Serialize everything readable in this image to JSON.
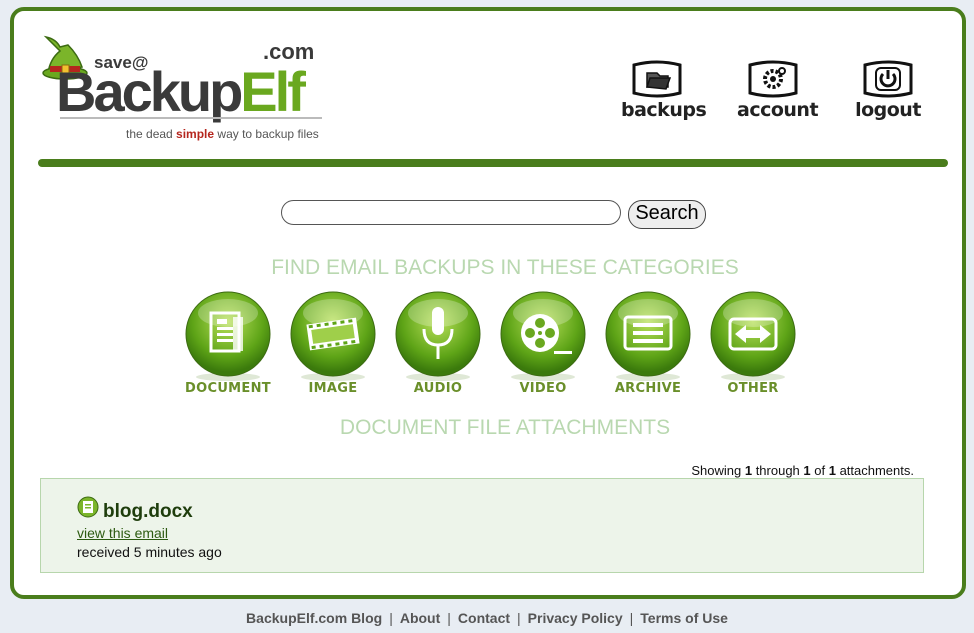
{
  "logo": {
    "dotcom": ".com",
    "save": "save@",
    "backup": "Backup",
    "elf": "Elf",
    "tagline_pre": "the dead ",
    "tagline_em": "simple",
    "tagline_post": " way to backup files"
  },
  "nav": {
    "backups": "backups",
    "account": "account",
    "logout": "logout"
  },
  "search": {
    "value": "",
    "button": "Search"
  },
  "categories_heading": "FIND EMAIL BACKUPS IN THESE CATEGORIES",
  "categories": [
    {
      "label": "DOCUMENT",
      "icon": "document-icon"
    },
    {
      "label": "IMAGE",
      "icon": "film-strip-icon"
    },
    {
      "label": "AUDIO",
      "icon": "microphone-icon"
    },
    {
      "label": "VIDEO",
      "icon": "film-reel-icon"
    },
    {
      "label": "ARCHIVE",
      "icon": "archive-icon"
    },
    {
      "label": "OTHER",
      "icon": "arrows-icon"
    }
  ],
  "results_heading": "DOCUMENT FILE ATTACHMENTS",
  "showing": {
    "pre": "Showing ",
    "from": "1",
    "mid": " through ",
    "to": "1",
    "of": " of ",
    "total": "1",
    "post": " attachments."
  },
  "result": {
    "file_name": "blog.docx",
    "view_link": "view this email",
    "received": "received 5 minutes ago"
  },
  "footer": {
    "blog": "BackupElf.com Blog",
    "about": "About",
    "contact": "Contact",
    "privacy": "Privacy Policy",
    "terms": "Terms of Use",
    "separator": "|"
  },
  "colors": {
    "brand_green": "#4a7d1c",
    "heading_green": "#b9d8b0",
    "result_bg": "#edf4ea"
  }
}
